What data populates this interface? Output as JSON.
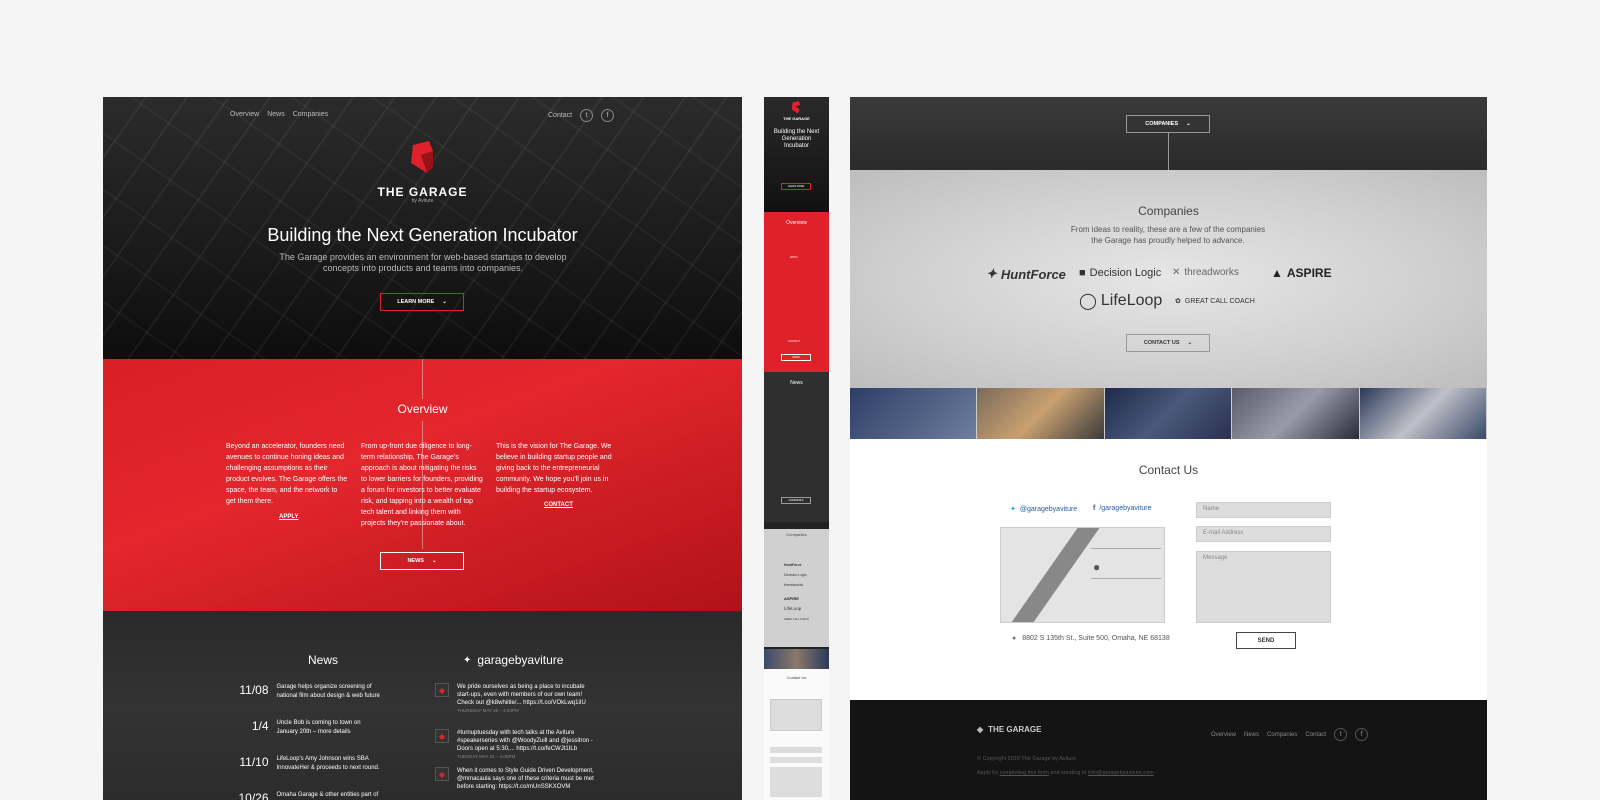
{
  "desktop": {
    "nav": {
      "overview": "Overview",
      "news": "News",
      "companies": "Companies",
      "contact": "Contact"
    },
    "brand": "THE GARAGE",
    "brand_sub": "by Aviture",
    "hero_title": "Building the Next Generation Incubator",
    "hero_desc": "The Garage provides an environment for web-based startups to develop concepts into products and teams into companies.",
    "learn_more": "LEARN MORE",
    "overview": {
      "title": "Overview",
      "col1": "Beyond an accelerator, founders need avenues to continue honing ideas and challenging assumptions as their product evolves. The Garage offers the space, the team, and the network to get them there.",
      "col1_link": "APPLY",
      "col2": "From up-front due diligence to long-term relationship, The Garage's approach is about mitigating the risks to lower barriers for founders, providing a forum for investors to better evaluate risk, and tapping into a wealth of top tech talent and linking them with projects they're passionate about.",
      "col3": "This is the vision for The Garage. We believe in building startup people and giving back to the entrepreneurial community. We hope you'll join us in building the startup ecosystem.",
      "col3_link": "CONTACT",
      "news_btn": "NEWS"
    },
    "news": {
      "title": "News",
      "items": [
        {
          "date": "11/08",
          "text": "Garage helps organize screening of national film about design & web future"
        },
        {
          "date": "1/4",
          "text": "Uncle Bob is coming to town on January 20th – more details"
        },
        {
          "date": "11/10",
          "text": "LifeLoop's Amy Johnson wins SBA InnovateHer & proceeds to next round."
        },
        {
          "date": "10/26",
          "text": "Omaha Garage & other entities part of"
        }
      ]
    },
    "twitter": {
      "handle": "garagebyaviture",
      "tweets": [
        {
          "text": "We pride ourselves as being a place to incubate start-ups, even with members of our own team! Check out @k8whiitle/... https://t.co/VOkLwq1iIU",
          "meta": "THURSDAY MAY 26 – 4:40PM"
        },
        {
          "text": "#turnuptuesday with tech talks at the Aviture #speakerseries with @WoodyZuill and @jessitron - Doors open at 5:30,... https://t.co/feCWJt1ILb",
          "meta": "TUESDAY MAY 24 – 3:06PM"
        },
        {
          "text": "When it comes to Style Guide Driven Development, @mmacaula says one of these criteria must be met before starting: https://t.co/mUnSSKXOVM",
          "meta": ""
        }
      ]
    }
  },
  "mobile": {
    "brand": "THE GARAGE",
    "hero_title": "Building the Next Generation Incubator",
    "learn_more": "LEARN MORE",
    "overview_title": "Overview",
    "apply": "APPLY",
    "contact": "CONTACT",
    "news_btn": "NEWS",
    "news_title": "News",
    "companies_btn": "COMPANIES",
    "companies_title": "Companies",
    "contact_title": "Contact Us",
    "logos": [
      "HuntForce",
      "Decision Logic",
      "threadworks",
      "ASPIRE",
      "LifeLoop",
      "GREAT CALL COACH"
    ]
  },
  "contact_page": {
    "companies_btn": "COMPANIES",
    "companies": {
      "title": "Companies",
      "desc": "From ideas to reality, these are a few of the companies the Garage has proudly helped to advance.",
      "logos": [
        "HuntForce",
        "Decision Logic",
        "threadworks",
        "ASPIRE",
        "LifeLoop",
        "GREAT CALL COACH"
      ],
      "contact_btn": "CONTACT US"
    },
    "contact": {
      "title": "Contact Us",
      "twitter": "@garagebyaviture",
      "facebook": "/garagebyaviture",
      "address": "8802 S 135th St., Suite 500, Omaha, NE 68138",
      "name_ph": "Name",
      "email_ph": "E-mail Address",
      "message_ph": "Message",
      "send": "SEND"
    },
    "footer": {
      "brand": "THE GARAGE",
      "nav": {
        "overview": "Overview",
        "news": "News",
        "companies": "Companies",
        "contact": "Contact"
      },
      "copyright": "© Copyright 2016 The Garage by Aviture",
      "apply_prefix": "Apply by",
      "apply_link": "completing this form",
      "apply_mid": "and sending to",
      "apply_email": "info@garagebyaviture.com"
    }
  },
  "colors": {
    "accent": "#e0202a",
    "dark": "#1a1a1a",
    "page_bg": "#f5f5f5"
  }
}
